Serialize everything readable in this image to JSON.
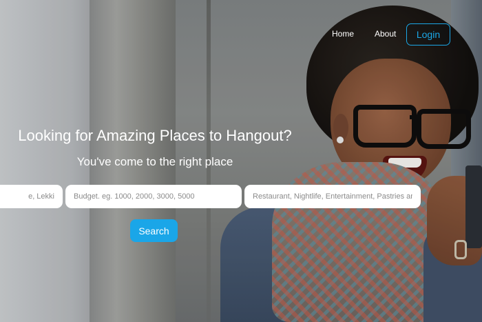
{
  "nav": {
    "home_label": "Home",
    "about_label": "About",
    "login_label": "Login"
  },
  "hero": {
    "title": "Looking for Amazing Places to Hangout?",
    "subtitle": "You've come to the right place"
  },
  "search": {
    "location_visible_text": "e, Lekki",
    "budget_placeholder": "Budget. eg. 1000, 2000, 3000, 5000",
    "category_placeholder": "Restaurant, Nightlife, Entertainment, Pastries an",
    "button_label": "Search"
  },
  "colors": {
    "accent": "#1aa6e8",
    "text_on_dark": "#ffffff",
    "input_bg": "#ffffff"
  }
}
